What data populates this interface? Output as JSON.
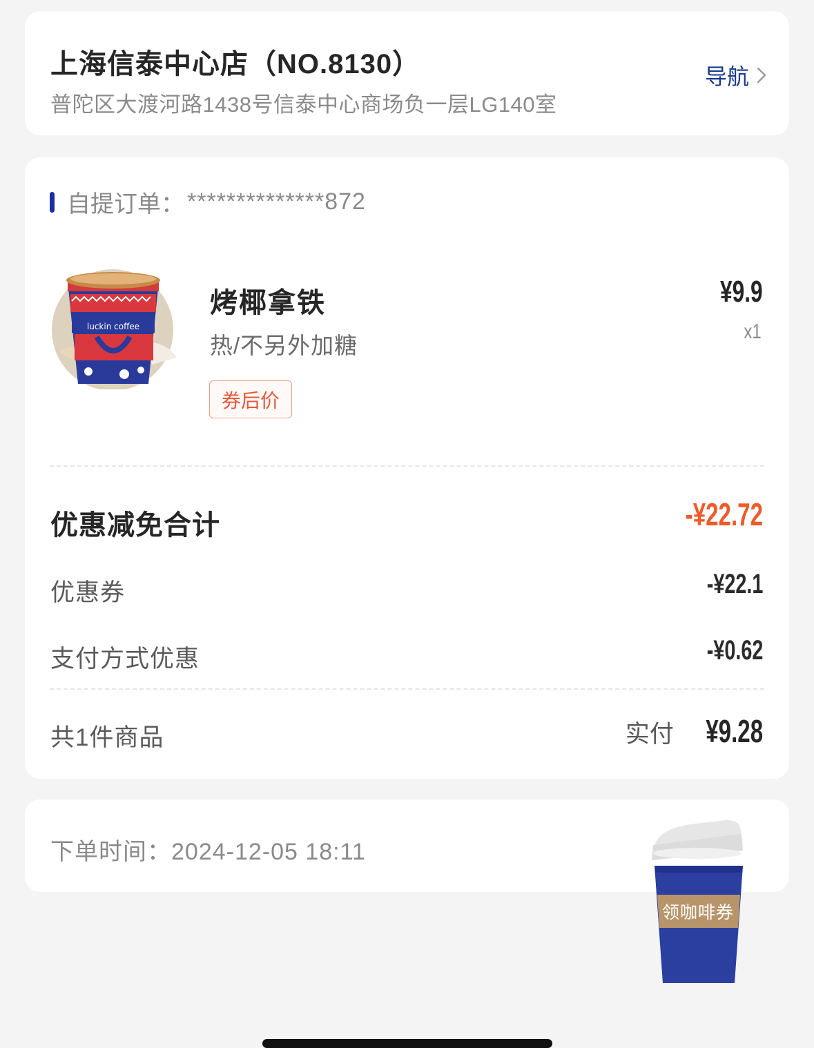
{
  "store": {
    "name": "上海信泰中心店（NO.8130）",
    "address": "普陀区大渡河路1438号信泰中心商场负一层LG140室",
    "nav_label": "导航"
  },
  "order": {
    "label": "自提订单：",
    "number": "**************872",
    "product": {
      "name": "烤椰拿铁",
      "spec": "热/不另外加糖",
      "tag": "券后价",
      "price": "¥9.9",
      "quantity": "x1"
    },
    "discount_total_label": "优惠减免合计",
    "discount_total_value": "-¥22.72",
    "coupon_label": "优惠券",
    "coupon_value": "-¥22.1",
    "paymethod_label": "支付方式优惠",
    "paymethod_value": "-¥0.62",
    "count_label": "共1件商品",
    "paid_label": "实付",
    "paid_value": "¥9.28"
  },
  "order_time": "下单时间：2024-12-05 18:11",
  "float_coupon": {
    "label": "领咖啡券"
  },
  "colors": {
    "accent_blue": "#1b2f9e",
    "discount_red": "#f05a2a",
    "background": "#f4f4f4"
  }
}
